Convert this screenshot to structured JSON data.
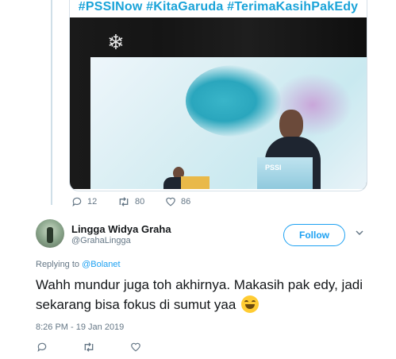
{
  "quoted_tweet": {
    "hashtags": "#PSSINow #KitaGaruda #TerimaKasihPakEdy",
    "podium_text": "PSSI",
    "stats": {
      "replies": "12",
      "retweets": "80",
      "likes": "86"
    }
  },
  "reply_tweet": {
    "display_name": "Lingga Widya Graha",
    "handle": "@GrahaLingga",
    "follow_label": "Follow",
    "replying_prefix": "Replying to",
    "replying_mention": "@Bolanet",
    "text": "Wahh mundur juga toh akhirnya. Makasih pak edy, jadi sekarang bisa fokus di sumut yaa",
    "timestamp": "8:26 PM - 19 Jan 2019"
  },
  "colors": {
    "accent": "#1da1f2",
    "muted": "#657786",
    "hashtag": "#1aa3d8",
    "text": "#14171a"
  },
  "icons": [
    "reply-icon",
    "retweet-icon",
    "like-icon",
    "chevron-down-icon",
    "grinning-squinting-face-emoji"
  ]
}
